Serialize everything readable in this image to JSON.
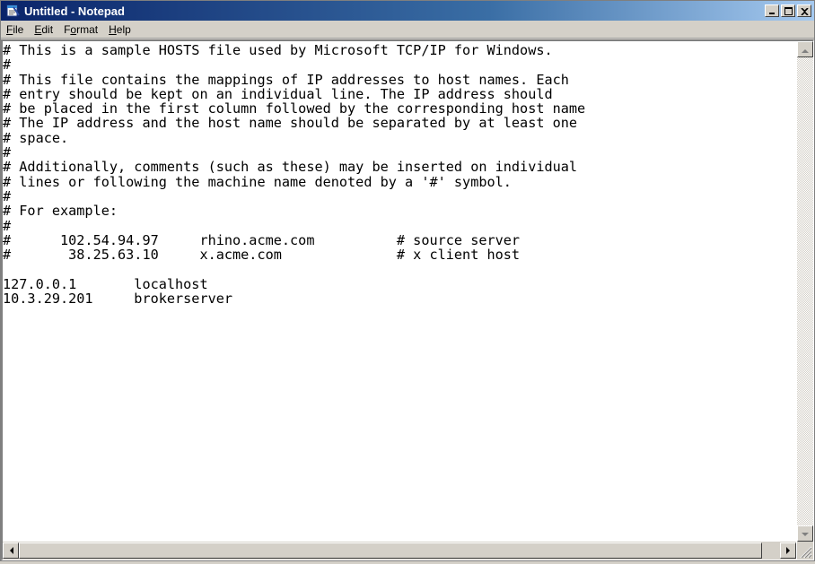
{
  "window": {
    "title": "Untitled - Notepad",
    "icon": "notepad-icon"
  },
  "caption_buttons": {
    "minimize_icon": "minimize-icon",
    "maximize_icon": "maximize-icon",
    "close_icon": "close-icon"
  },
  "menu": [
    {
      "label": "File",
      "accelerator": "F"
    },
    {
      "label": "Edit",
      "accelerator": "E"
    },
    {
      "label": "Format",
      "accelerator": "o"
    },
    {
      "label": "Help",
      "accelerator": "H"
    }
  ],
  "editor": {
    "lines": [
      "# This is a sample HOSTS file used by Microsoft TCP/IP for Windows.",
      "#",
      "# This file contains the mappings of IP addresses to host names. Each",
      "# entry should be kept on an individual line. The IP address should",
      "# be placed in the first column followed by the corresponding host name",
      "# The IP address and the host name should be separated by at least one",
      "# space.",
      "#",
      "# Additionally, comments (such as these) may be inserted on individual",
      "# lines or following the machine name denoted by a '#' symbol.",
      "#",
      "# For example:",
      "#",
      "#      102.54.94.97     rhino.acme.com          # source server",
      "#       38.25.63.10     x.acme.com              # x client host",
      "",
      "127.0.0.1       localhost",
      "10.3.29.201     brokerserver"
    ]
  },
  "colors": {
    "titlebar_start": "#0a246a",
    "titlebar_end": "#a6caf0",
    "chrome": "#d4d0c8"
  }
}
